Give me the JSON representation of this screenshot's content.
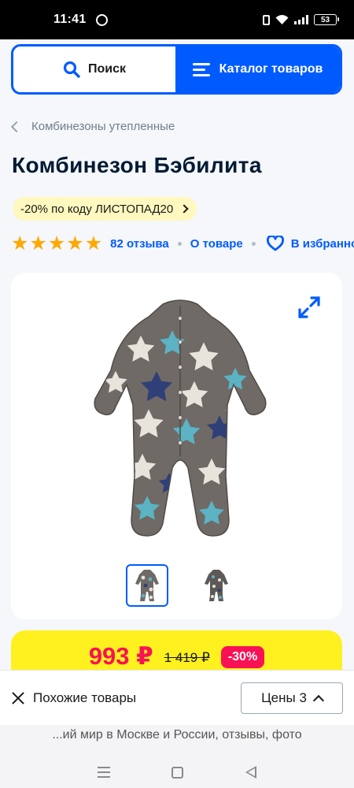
{
  "status_bar": {
    "time": "11:41",
    "battery": "53"
  },
  "nav": {
    "search_label": "Поиск",
    "catalog_label": "Каталог товаров"
  },
  "breadcrumb": "Комбинезоны утепленные",
  "product": {
    "title": "Комбинезон Бэбилита",
    "promo": "-20% по коду ЛИСТОПАД20",
    "rating_stars": 5,
    "reviews_link": "82 отзыва",
    "about_link": "О товаре",
    "favorite_link": "В избранное",
    "image_count": 2,
    "selected_image": 1
  },
  "price": {
    "current": "993 ₽",
    "old": "1 419 ₽",
    "discount": "-30%"
  },
  "bottom_sheet": {
    "similar_label": "Похожие товары",
    "prices_label": "Цены",
    "prices_count": "3"
  },
  "browser": {
    "page_title": "...ий мир в Москве и России, отзывы, фото"
  },
  "colors": {
    "accent": "#005bff",
    "price_red": "#f91155",
    "price_bar": "#fef11f",
    "star": "#ffa800",
    "promo_bg": "#fff8bf"
  }
}
